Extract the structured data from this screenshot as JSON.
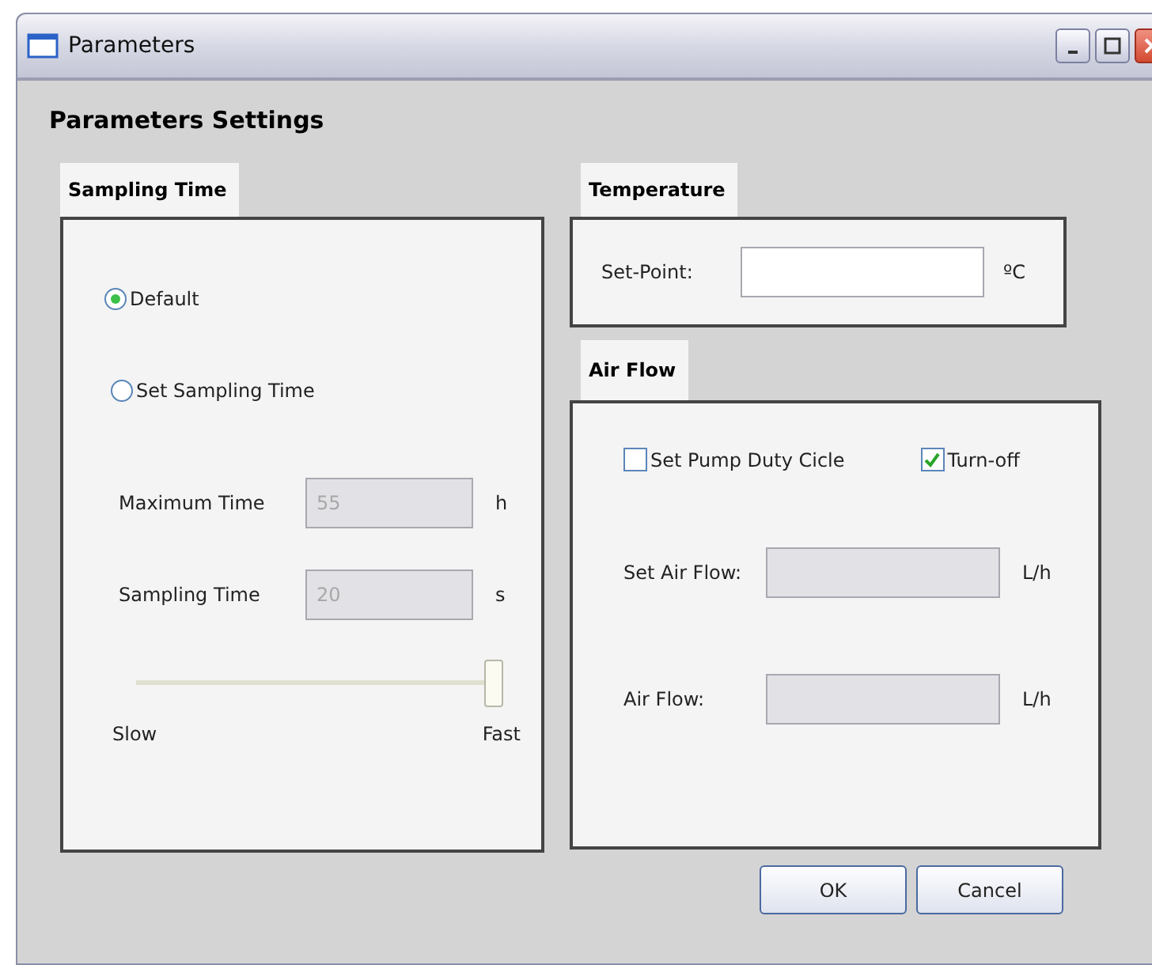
{
  "window": {
    "title": "Parameters"
  },
  "heading": "Parameters Settings",
  "sampling": {
    "title": "Sampling Time",
    "options": [
      {
        "label": "Default",
        "selected": true
      },
      {
        "label": "Set Sampling Time",
        "selected": false
      }
    ],
    "fields": [
      {
        "label": "Maximum Time",
        "value": "55",
        "unit": "h",
        "disabled": true
      },
      {
        "label": "Sampling Time",
        "value": "20",
        "unit": "s",
        "disabled": true
      }
    ],
    "slider": {
      "level": 1,
      "min_label": "Slow",
      "max_label": "Fast"
    }
  },
  "temperature": {
    "title": "Temperature",
    "field": {
      "label": "Set-Point:",
      "unit": "ºC",
      "disabled": false
    }
  },
  "air_flow": {
    "title": "Air Flow",
    "checkboxes": [
      {
        "label": "Set Pump Duty Cicle",
        "checked": false
      },
      {
        "label": "Turn-off",
        "checked": true
      }
    ],
    "fields": [
      {
        "label": "Set Air Flow:",
        "unit": "L/h",
        "disabled": true
      },
      {
        "label": "Air Flow:",
        "unit": "L/h",
        "disabled": true
      }
    ]
  },
  "buttons": [
    "OK",
    "Cancel"
  ]
}
